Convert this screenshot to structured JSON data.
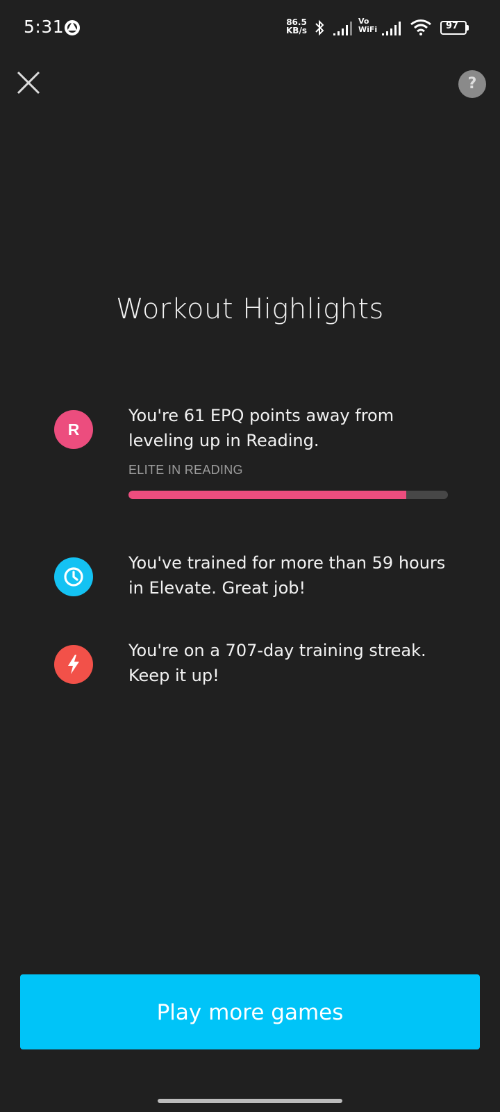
{
  "status_bar": {
    "time": "5:31",
    "net_speed_value": "86.5",
    "net_speed_unit": "KB/s",
    "vowifi_top": "Vo",
    "vowifi_bottom": "WiFi",
    "battery_level": "97"
  },
  "header": {
    "close_icon": "close-icon",
    "help_label": "?"
  },
  "title": "Workout Highlights",
  "highlights": [
    {
      "icon_letter": "R",
      "icon_color": "#ec4d7e",
      "text": "You're 61 EPQ points away from leveling up in Reading.",
      "level_label": "ELITE IN READING",
      "progress_fraction": 0.87
    },
    {
      "icon": "clock-icon",
      "icon_color": "#14c2f3",
      "text": "You've trained for more than 59 hours in Elevate. Great job!"
    },
    {
      "icon": "lightning-icon",
      "icon_color": "#f25149",
      "text": "You're on a 707-day training streak. Keep it up!"
    }
  ],
  "cta": {
    "label": "Play more games",
    "color": "#00c4f8"
  }
}
